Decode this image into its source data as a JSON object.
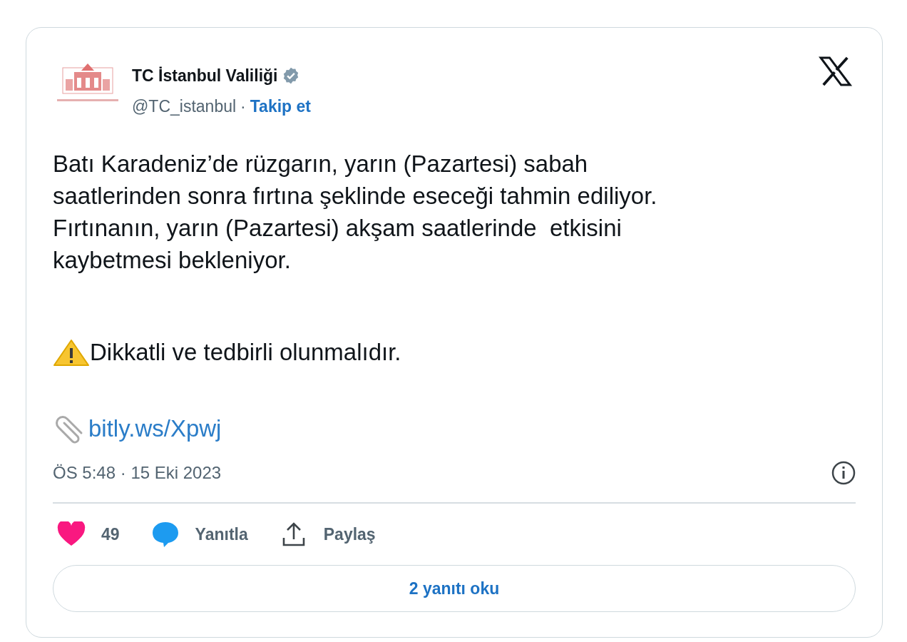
{
  "account": {
    "name": "TC İstanbul Valiliği",
    "verified": true,
    "handle": "@TC_istanbul",
    "separator": "·",
    "follow": "Takip et"
  },
  "body": [
    {
      "kind": "text",
      "text": "Batı Karadeniz’de rüzgarın, yarın (Pazartesi) sabah\nsaatlerinden sonra fırtına şeklinde eseceği tahmin ediliyor.\nFırtınanın, yarın (Pazartesi) akşam saatlerinde  etkisini\nkaybetmesi bekleniyor."
    },
    {
      "kind": "warning",
      "text": "Dikkatli ve tedbirli olunmalıdır."
    },
    {
      "kind": "link",
      "text": "bitly.ws/Xpwj"
    }
  ],
  "timestamp": "ÖS 5:48 · 15 Eki 2023",
  "actions": [
    {
      "kind": "like",
      "label": "49"
    },
    {
      "kind": "reply",
      "label": "Yanıtla"
    },
    {
      "kind": "share",
      "label": "Paylaş"
    }
  ],
  "read_replies": "2 yanıtı oku"
}
